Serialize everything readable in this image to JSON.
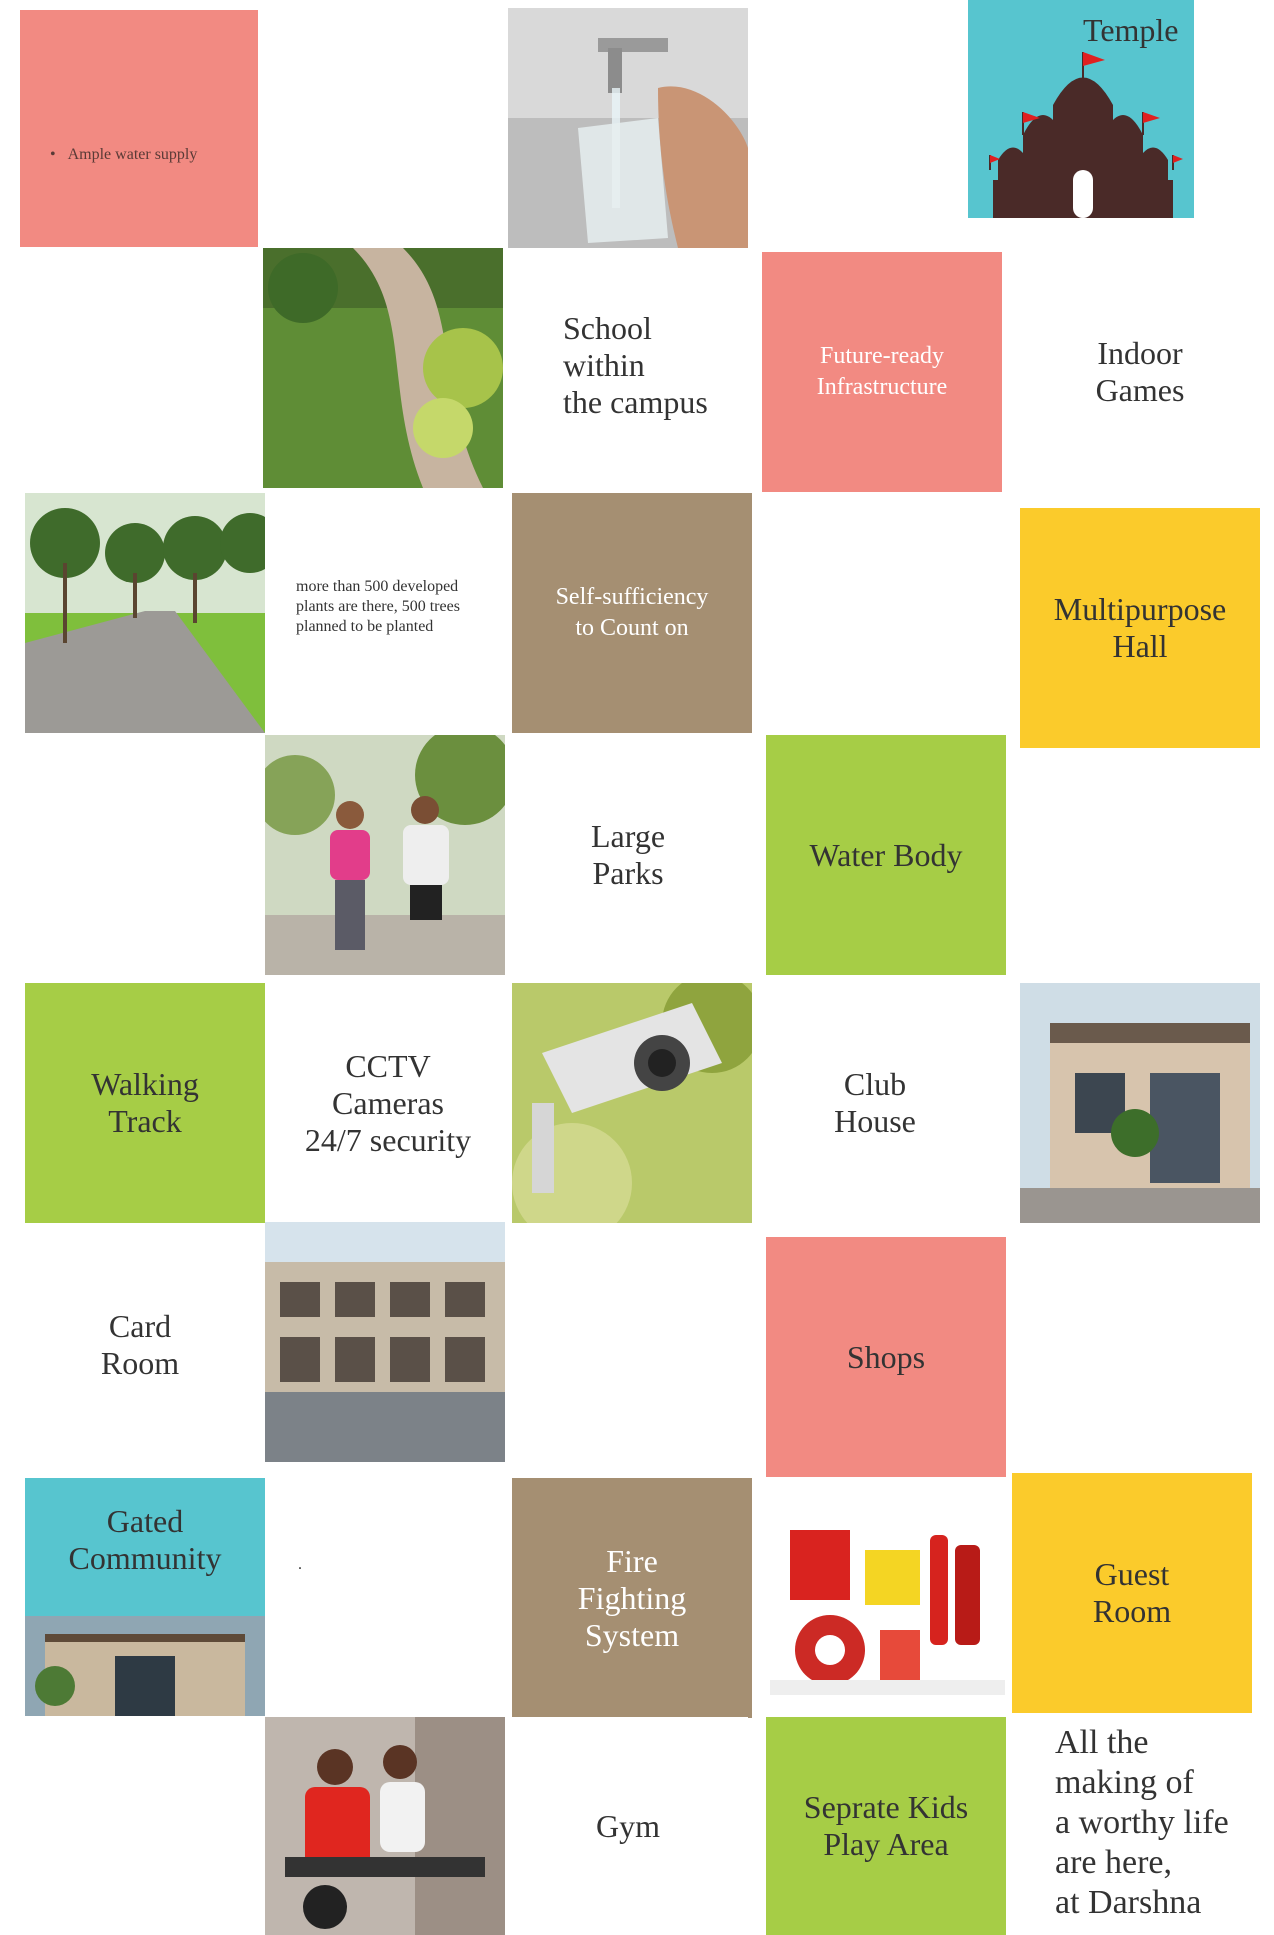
{
  "tiles": {
    "ample_water": "Ample water supply",
    "temple": "Temple",
    "school": "School\nwithin\nthe campus",
    "future_ready": "Future-ready\nInfrastructure",
    "indoor_games": "Indoor\nGames",
    "plants": "more than 500 developed\nplants are there, 500 trees\nplanned to be planted",
    "self_sufficiency": "Self-sufficiency\nto Count on",
    "multipurpose": "Multipurpose\nHall",
    "large_parks": "Large\nParks",
    "water_body": "Water Body",
    "walking_track": "Walking\nTrack",
    "cctv": "CCTV\nCameras\n24/7 security",
    "club_house": "Club\nHouse",
    "card_room": "Card\nRoom",
    "shops": "Shops",
    "gated_community": "Gated\nCommunity",
    "dot": ".",
    "fire_fighting": "Fire\nFighting\nSystem",
    "guest_room": "Guest\nRoom",
    "gym": "Gym",
    "kids_play": "Seprate Kids\nPlay Area",
    "tagline": "All the\nmaking of\na worthy life\nare here,\nat Darshna"
  },
  "icons": {
    "bullet": "•",
    "temple_flag_color": "#e02020",
    "temple_body_color": "#4a2a28"
  },
  "colors": {
    "pink": "#f28a82",
    "teal": "#57c5cf",
    "brown": "#a58f72",
    "lime": "#a6cd46",
    "yellow": "#fbcb2b"
  }
}
